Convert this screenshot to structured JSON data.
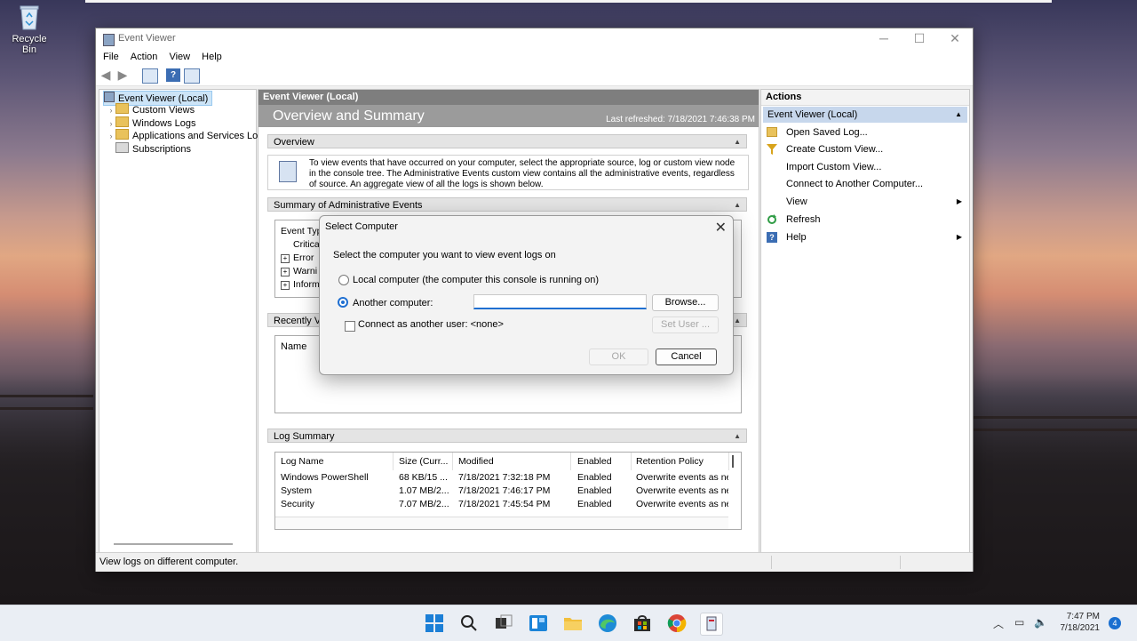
{
  "desktop": {
    "recycle_bin": "Recycle Bin"
  },
  "window": {
    "title": "Event Viewer",
    "controls": {
      "minimize": "─",
      "maximize": "☐",
      "close": "✕"
    }
  },
  "menu": [
    "File",
    "Action",
    "View",
    "Help"
  ],
  "tree": {
    "items": [
      {
        "label": "Event Viewer (Local)",
        "icon": "event-viewer-icon",
        "selected": true
      },
      {
        "label": "Custom Views",
        "icon": "folder-icon"
      },
      {
        "label": "Windows Logs",
        "icon": "folder-icon"
      },
      {
        "label": "Applications and Services Lo",
        "icon": "folder-icon"
      },
      {
        "label": "Subscriptions",
        "icon": "subscriptions-icon"
      }
    ]
  },
  "center": {
    "header": "Event Viewer (Local)",
    "overview_title": "Overview and Summary",
    "last_refreshed": "Last refreshed: 7/18/2021 7:46:38 PM",
    "overview_section": "Overview",
    "overview_text": "To view events that have occurred on your computer, select the appropriate source, log or custom view node in the console tree. The Administrative Events custom view contains all the administrative events, regardless of source. An aggregate view of all the logs is shown below.",
    "admin_section": "Summary of Administrative Events",
    "admin_rows": [
      "Event Typ",
      "Critica",
      "Error",
      "Warni",
      "Inform"
    ],
    "recent_section": "Recently Vi",
    "recent_name_col": "Name",
    "log_section": "Log Summary",
    "log_columns": [
      "Log Name",
      "Size (Curr...",
      "Modified",
      "Enabled",
      "Retention Policy"
    ],
    "log_rows": [
      [
        "Windows PowerShell",
        "68 KB/15 ...",
        "7/18/2021 7:32:18 PM",
        "Enabled",
        "Overwrite events as ne"
      ],
      [
        "System",
        "1.07 MB/2...",
        "7/18/2021 7:46:17 PM",
        "Enabled",
        "Overwrite events as ne"
      ],
      [
        "Security",
        "7.07 MB/2...",
        "7/18/2021 7:45:54 PM",
        "Enabled",
        "Overwrite events as ne"
      ]
    ]
  },
  "actions": {
    "header": "Actions",
    "group": "Event Viewer (Local)",
    "items": [
      {
        "label": "Open Saved Log...",
        "icon": "open-folder-icon",
        "submenu": false
      },
      {
        "label": "Create Custom View...",
        "icon": "filter-icon",
        "submenu": false
      },
      {
        "label": "Import Custom View...",
        "icon": "",
        "submenu": false
      },
      {
        "label": "Connect to Another Computer...",
        "icon": "",
        "submenu": false
      },
      {
        "label": "View",
        "icon": "",
        "submenu": true
      },
      {
        "label": "Refresh",
        "icon": "refresh-icon",
        "submenu": false
      },
      {
        "label": "Help",
        "icon": "help-icon",
        "submenu": true
      }
    ]
  },
  "status": {
    "text": "View logs on different computer."
  },
  "dialog": {
    "title": "Select Computer",
    "prompt": "Select the computer you want to view event logs on",
    "local_option": "Local computer (the computer this console is running on)",
    "another_option": "Another computer:",
    "another_value": "",
    "browse": "Browse...",
    "connect_as": "Connect as another user: <none>",
    "set_user": "Set User ...",
    "ok": "OK",
    "cancel": "Cancel",
    "selected_option": "another"
  },
  "taskbar": {
    "time": "7:47 PM",
    "date": "7/18/2021",
    "notifications": "4"
  },
  "colors": {
    "accent": "#1f6fd1",
    "selection": "#cce4f7",
    "actions_group": "#c7d7ec"
  }
}
